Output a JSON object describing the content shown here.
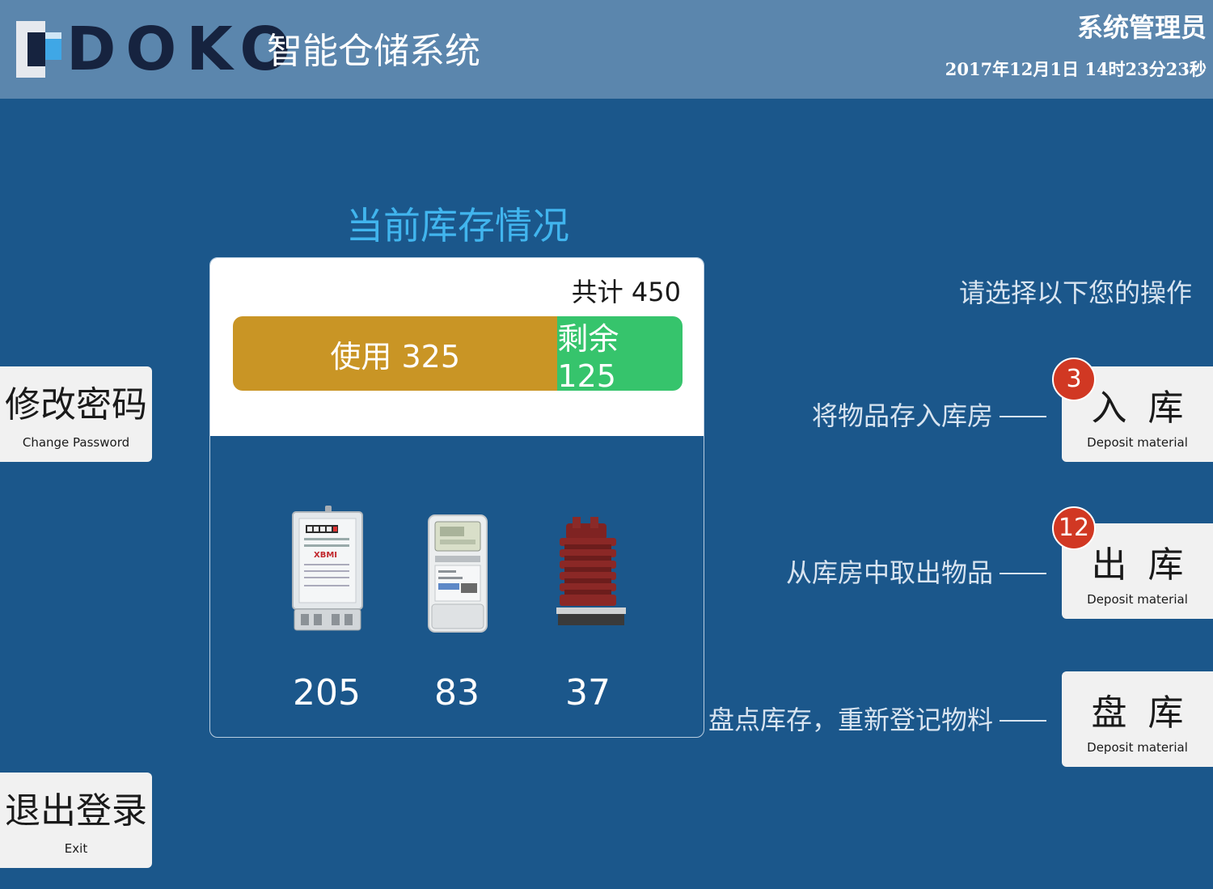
{
  "header": {
    "brand": "DOKO",
    "app_name": "智能仓储系统",
    "user_role": "系统管理员",
    "datetime": "2017年12月1日  14时23分23秒"
  },
  "inventory": {
    "title": "当前库存情况",
    "total_label": "共计 450",
    "used_label": "使用 325",
    "remaining_label": "剩余 125",
    "used_fraction": 0.722,
    "products": [
      {
        "icon": "single-phase-meter-icon",
        "count": "205"
      },
      {
        "icon": "three-phase-meter-icon",
        "count": "83"
      },
      {
        "icon": "current-transformer-icon",
        "count": "37"
      }
    ]
  },
  "side_buttons": {
    "change_password": {
      "cn": "修改密码",
      "en": "Change Password"
    },
    "exit": {
      "cn": "退出登录",
      "en": "Exit"
    }
  },
  "operations": {
    "prompt": "请选择以下您的操作",
    "items": [
      {
        "desc": "将物品存入库房",
        "cn": "入库",
        "en": "Deposit material",
        "badge": "3"
      },
      {
        "desc": "从库房中取出物品",
        "cn": "出库",
        "en": "Deposit material",
        "badge": "12"
      },
      {
        "desc": "盘点库存，重新登记物料",
        "cn": "盘库",
        "en": "Deposit material",
        "badge": ""
      }
    ]
  },
  "colors": {
    "background": "#1b578b",
    "header": "#5b86ad",
    "title_accent": "#41b5ee",
    "used": "#c99525",
    "remaining": "#36c46c",
    "badge": "#d13823"
  }
}
